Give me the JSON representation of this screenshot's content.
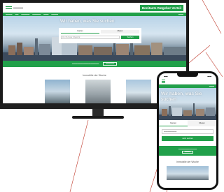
{
  "colors": {
    "brand_green": "#21a04a",
    "device_black": "#1b1b1b",
    "sky_blue": "#b8d3e8"
  },
  "desktop": {
    "header": {
      "cta_label": "Bonitaets Ratgeber Vorteil"
    },
    "hero": {
      "headline": "Wir haben, was Sie suchen",
      "tabs": [
        "Kaufen",
        "Mieten"
      ],
      "search_placeholder": "Ort, PLZ oder Objekt-Nr.",
      "search_button": "Suchen"
    },
    "section": {
      "title": "Immobilie der Woche"
    }
  },
  "mobile": {
    "hero": {
      "headline": "Wir haben, was Sie suchen",
      "tabs": [
        "Kaufen",
        "Mieten"
      ],
      "search_button": "Jetzt suchen"
    },
    "section": {
      "title": "Immobilie der Woche"
    }
  }
}
